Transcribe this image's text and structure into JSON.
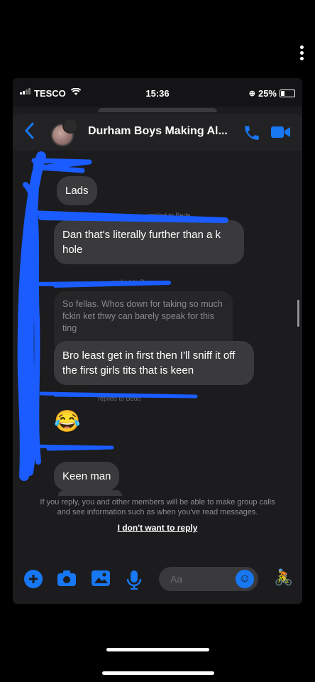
{
  "status": {
    "carrier": "TESCO",
    "time": "15:36",
    "battery": "25%",
    "battery_level": 0.25
  },
  "header": {
    "title": "Durham Boys Making Al...",
    "back_icon": "chevron-left-icon",
    "call_icon": "phone-icon",
    "video_icon": "video-camera-icon"
  },
  "messages": {
    "m1": "Lads",
    "meta1": "replied to Bede",
    "m2": "Dan that's literally further than a k hole",
    "meta2": "replied to Dan",
    "m3_quoted": "So fellas. Whos down for taking so much fckin ket thwy can barely speak for this ting",
    "m3": "Bro least get in first then I'll sniff it off the first girls tits that is keen",
    "meta3": "replied to Bede",
    "m4_emoji": "😂",
    "m5": "Keen man"
  },
  "notice": {
    "text": "If you reply, you and other members will be able to make group calls and see information such as when you've read messages.",
    "link": "I don't want to reply"
  },
  "composer": {
    "placeholder": "Aa",
    "accent": "#1877f2",
    "thumb_emoji": "🚴"
  },
  "colors": {
    "accent": "#1877f2",
    "scribble": "#1a5cff",
    "bubble": "#3a3a3c"
  }
}
